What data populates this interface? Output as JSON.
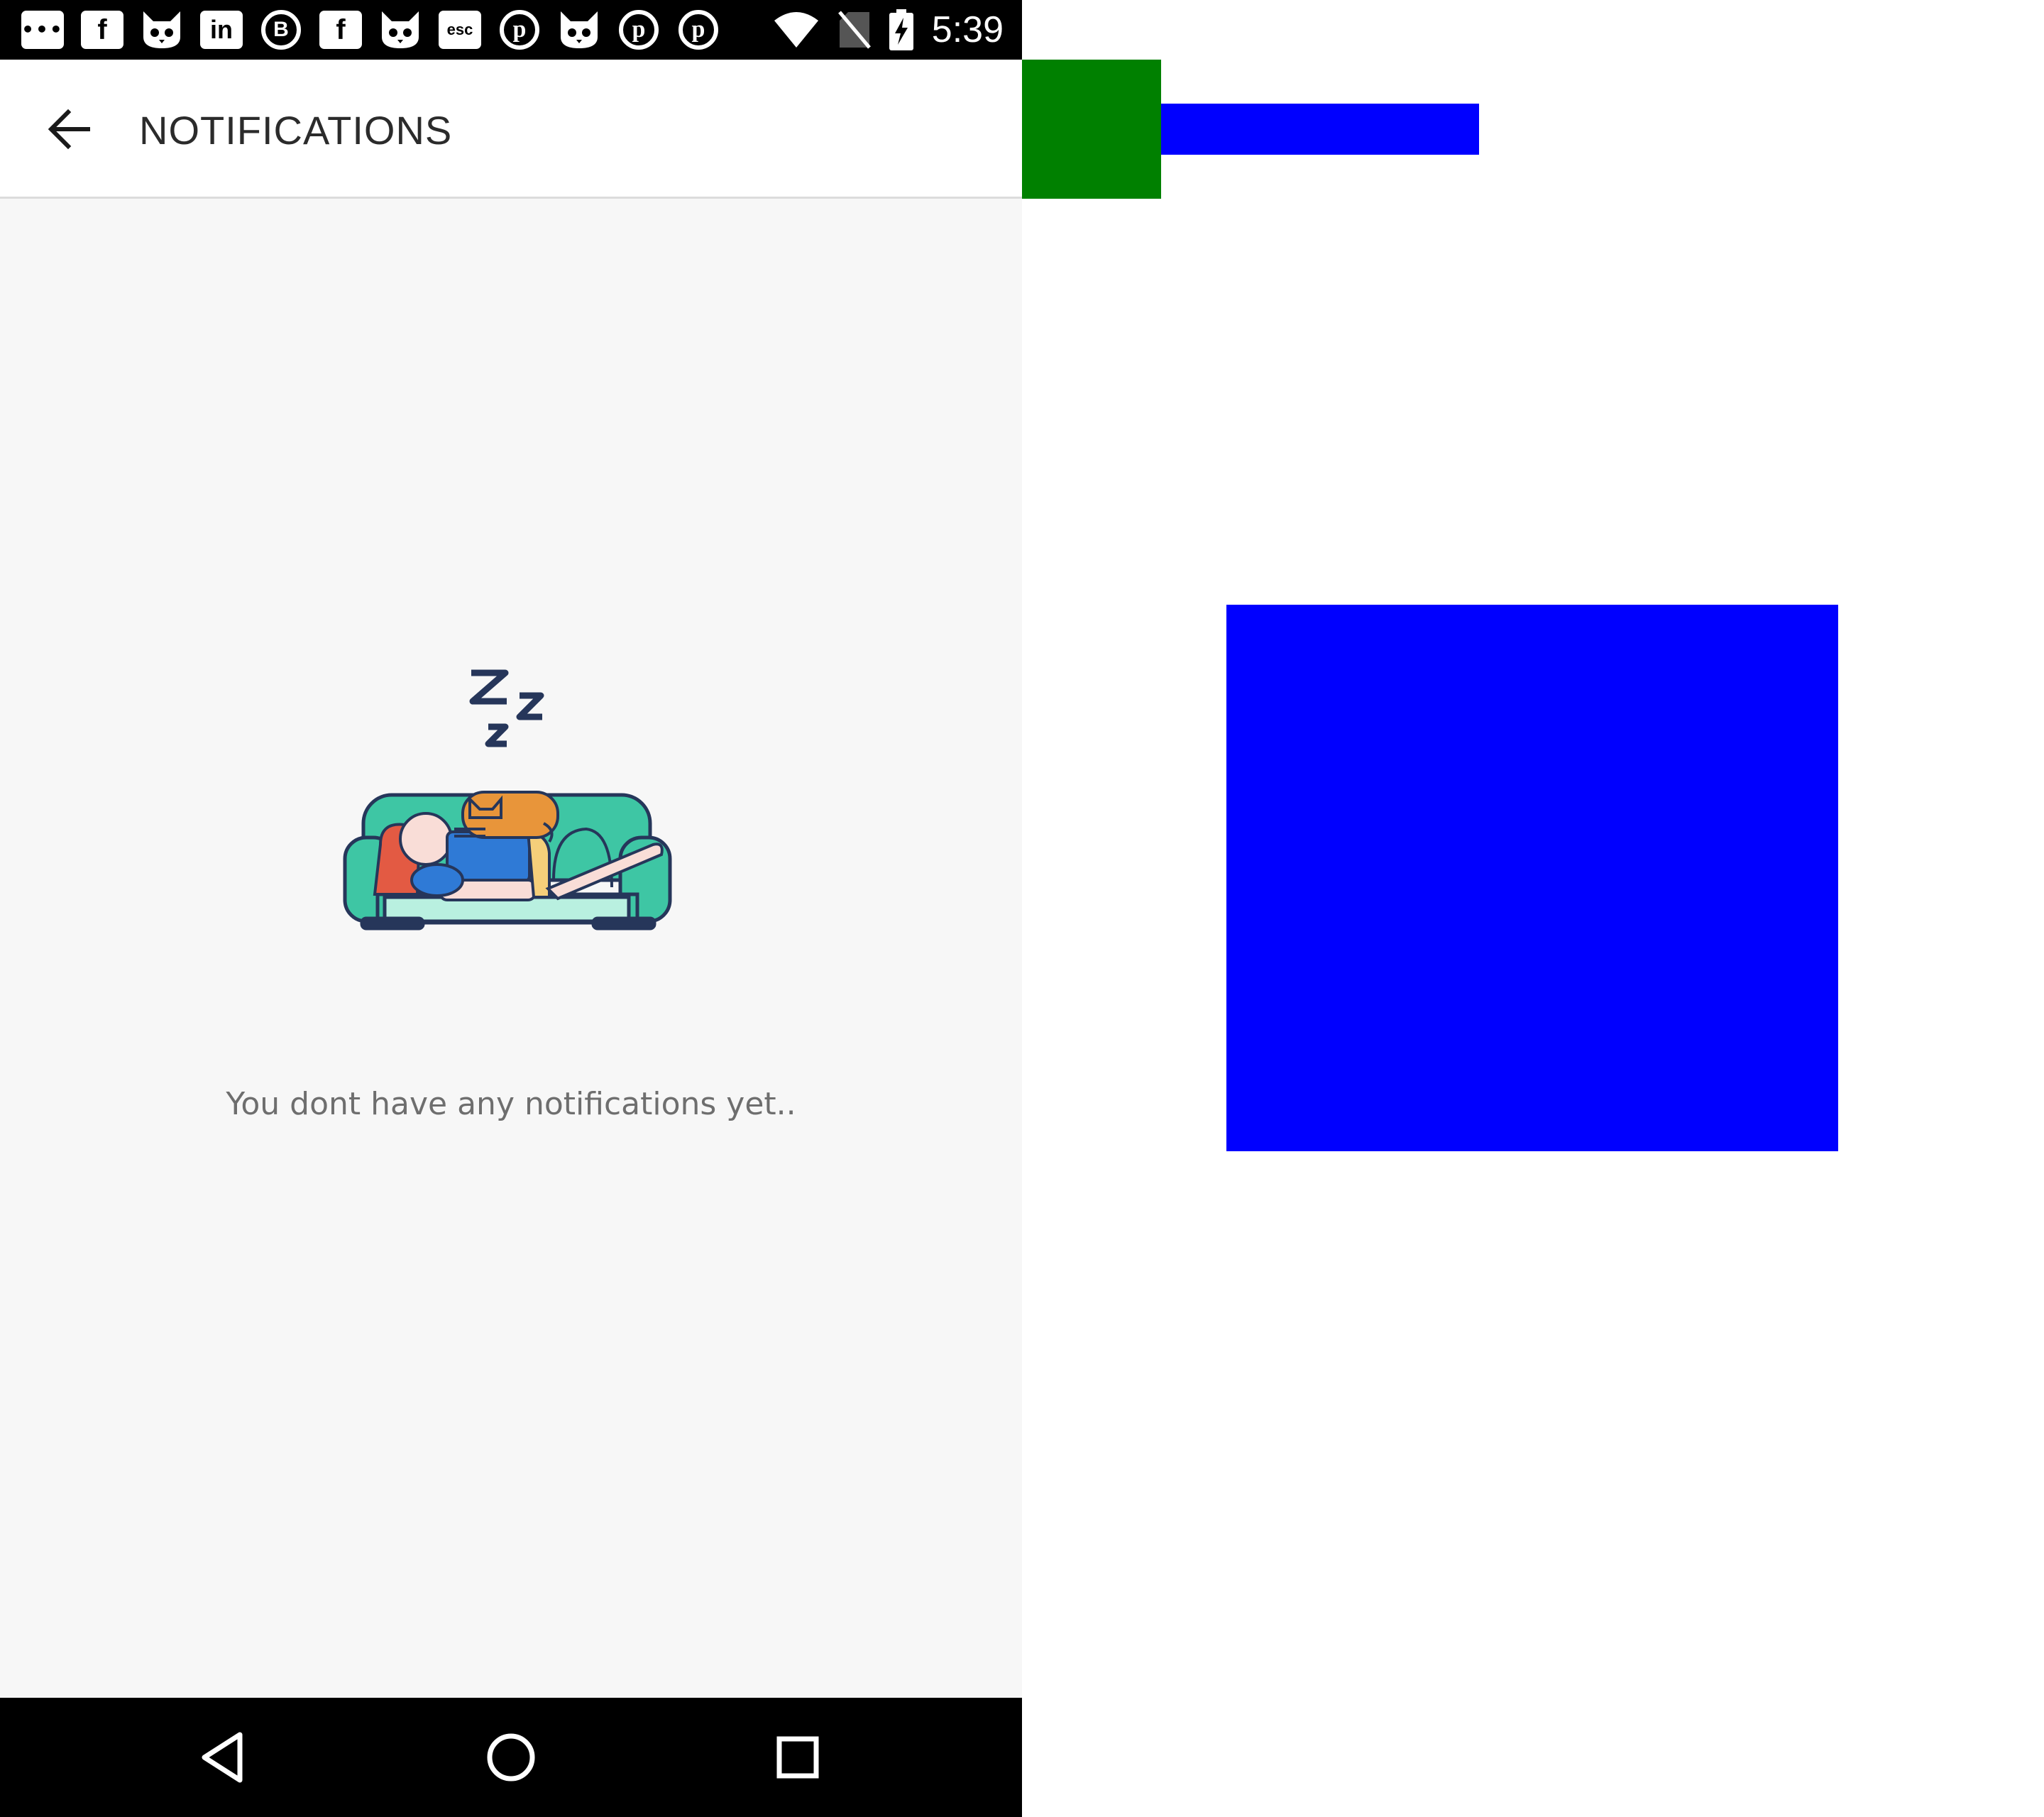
{
  "status_bar": {
    "time": "5:39",
    "notification_icons": [
      {
        "name": "messaging-icon",
        "glyph": "•••"
      },
      {
        "name": "facebook-icon",
        "glyph": "f"
      },
      {
        "name": "cat-app-icon",
        "glyph": "🐱"
      },
      {
        "name": "linkedin-icon",
        "glyph": "in"
      },
      {
        "name": "b-chat-icon",
        "glyph": "B"
      },
      {
        "name": "facebook-icon",
        "glyph": "f"
      },
      {
        "name": "cat-app-icon",
        "glyph": "🐱"
      },
      {
        "name": "esc-app-icon",
        "glyph": "esc"
      },
      {
        "name": "pinterest-icon",
        "glyph": "p"
      },
      {
        "name": "cat-app-icon",
        "glyph": "🐱"
      },
      {
        "name": "pinterest-icon",
        "glyph": "p"
      },
      {
        "name": "pinterest-icon",
        "glyph": "p"
      }
    ],
    "system_icons": [
      "wifi-icon",
      "no-sim-icon",
      "battery-charging-icon"
    ]
  },
  "app_bar": {
    "title": "NOTIFICATIONS",
    "back_icon": "arrow-left-icon"
  },
  "empty_state": {
    "illustration": "sleeping-on-couch-illustration",
    "zzz": "Zzz",
    "message": "You dont have any notifications yet.."
  },
  "nav_bar": {
    "buttons": [
      "nav-back-icon",
      "nav-home-icon",
      "nav-recents-icon"
    ]
  },
  "colors": {
    "status_bar": "#000000",
    "app_bar": "#ffffff",
    "background": "#f7f7f7",
    "title_text": "#2b2b2b",
    "message_text": "#6e6e6e",
    "annotation_green": "#008000",
    "annotation_blue": "#0000ff"
  }
}
